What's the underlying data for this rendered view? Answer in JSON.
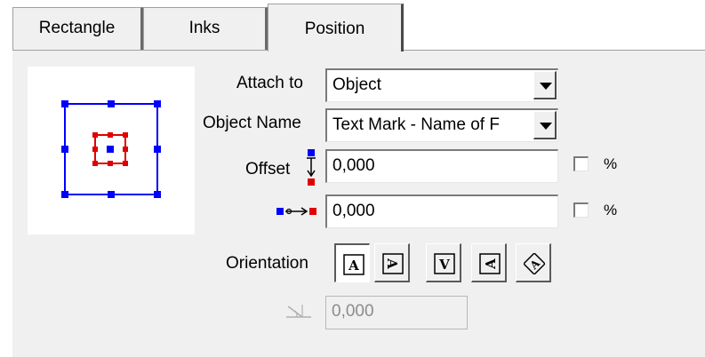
{
  "tabs": [
    {
      "label": "Rectangle"
    },
    {
      "label": "Inks"
    },
    {
      "label": "Position"
    }
  ],
  "active_tab": "Position",
  "position": {
    "attach_to": {
      "label": "Attach to",
      "value": "Object"
    },
    "object_name": {
      "label": "Object Name",
      "value": "Text Mark - Name of F"
    },
    "offset": {
      "label": "Offset",
      "vertical_value": "0,000",
      "horizontal_value": "0,000",
      "vertical_percent_label": "%",
      "horizontal_percent_label": "%"
    },
    "orientation": {
      "label": "Orientation",
      "options": [
        "A",
        "A-rot90",
        "V",
        "A-rot270",
        "A-diag"
      ],
      "selected": "A"
    },
    "angle": {
      "value": "0,000",
      "icon": "angle-icon"
    }
  },
  "colors": {
    "anchor_blue": "#0000ff",
    "anchor_red": "#e00000",
    "panel": "#f0f0f0"
  }
}
